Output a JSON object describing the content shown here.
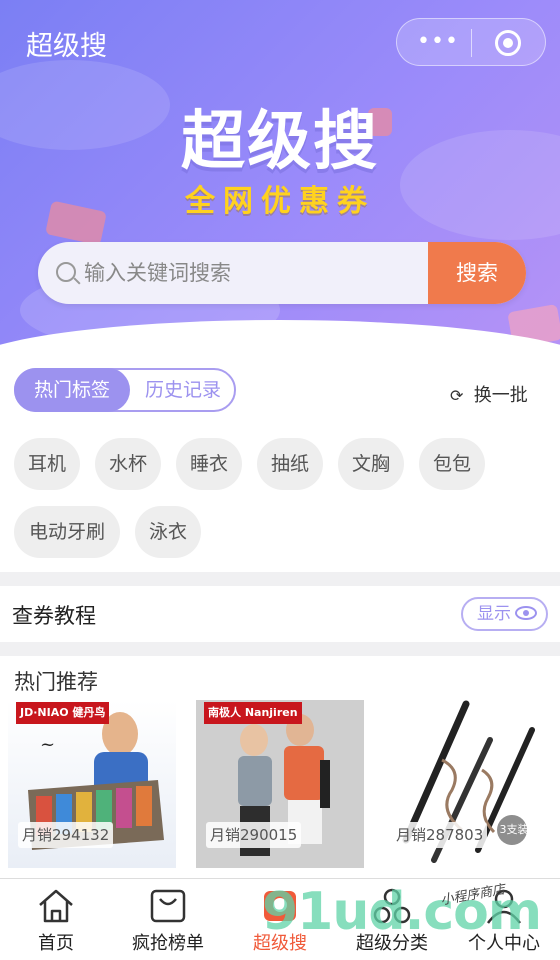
{
  "header": {
    "app_title": "超级搜",
    "menu_icon": "more-dots-icon",
    "close_icon": "target-icon"
  },
  "banner": {
    "title": "超级搜",
    "subtitle": "全网优惠券"
  },
  "search": {
    "placeholder": "输入关键词搜索",
    "value": "",
    "button": "搜索"
  },
  "tags": {
    "toggle": {
      "active": "热门标签",
      "inactive": "历史记录"
    },
    "refresh_label": "换一批",
    "items": [
      "耳机",
      "水杯",
      "睡衣",
      "抽纸",
      "文胸",
      "包包",
      "电动牙刷",
      "泳衣"
    ]
  },
  "guide": {
    "label": "查券教程",
    "show_button": "显示"
  },
  "recommend": {
    "label": "热门推荐",
    "products": [
      {
        "brand": "JD·NIAO 健丹鸟",
        "sales": "月销294132"
      },
      {
        "brand": "南极人 Nanjiren",
        "sales": "月销290015"
      },
      {
        "brand": "",
        "sales": "月销287803",
        "badge": "3支装"
      }
    ]
  },
  "tabbar": {
    "items": [
      {
        "label": "首页",
        "icon": "home-icon"
      },
      {
        "label": "疯抢榜单",
        "icon": "shopping-bag-icon"
      },
      {
        "label": "超级搜",
        "icon": "super-search-icon"
      },
      {
        "label": "超级分类",
        "icon": "category-icon"
      },
      {
        "label": "个人中心",
        "icon": "user-icon"
      }
    ],
    "active_index": 2
  },
  "watermark": {
    "brand": "91ud.com",
    "note": "小程序商店"
  },
  "colors": {
    "accent": "#9c92ef",
    "search_button": "#f07a4c",
    "active_tab": "#f05a3a",
    "coupon_yellow": "#ffd21f"
  }
}
